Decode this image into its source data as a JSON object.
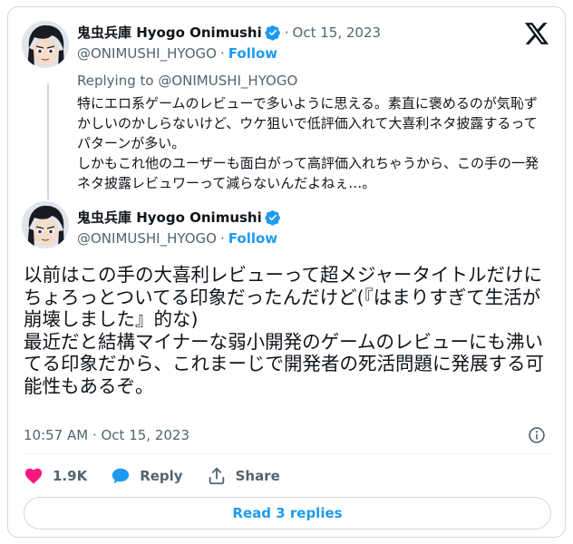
{
  "reply_tweet": {
    "author_name": "鬼虫兵庫 Hyogo Onimushi",
    "handle": "@ONIMUSHI_HYOGO",
    "follow_label": "Follow",
    "date": "Oct 15, 2023",
    "replying_to": "Replying to @ONIMUSHI_HYOGO",
    "text": "特にエロ系ゲームのレビューで多いように思える。素直に褒めるのが気恥ずかしいのかしらないけど、ウケ狙いで低評価入れて大喜利ネタ披露するってパターンが多い。\nしかもこれ他のユーザーも面白がって高評価入れちゃうから、この手の一発ネタ披露レビュワーって減らないんだよねぇ…。"
  },
  "main_tweet": {
    "author_name": "鬼虫兵庫 Hyogo Onimushi",
    "handle": "@ONIMUSHI_HYOGO",
    "follow_label": "Follow",
    "text": "以前はこの手の大喜利レビューって超メジャータイトルだけにちょろっとついてる印象だったんだけど(『はまりすぎて生活が崩壊しました』的な)\n最近だと結構マイナーな弱小開発のゲームのレビューにも沸いてる印象だから、これまーじで開発者の死活問題に発展する可能性もあるぞ。",
    "timestamp": "10:57 AM · Oct 15, 2023"
  },
  "actions": {
    "like_count": "1.9K",
    "reply_label": "Reply",
    "share_label": "Share"
  },
  "read_replies_label": "Read 3 replies",
  "separator": "·",
  "colors": {
    "accent": "#1d9bf0",
    "like": "#f91880",
    "muted": "#536471",
    "border": "#cfd9de"
  },
  "icons": [
    "verified-badge-icon",
    "x-logo-icon",
    "info-icon",
    "heart-icon",
    "reply-bubble-icon",
    "share-icon"
  ]
}
